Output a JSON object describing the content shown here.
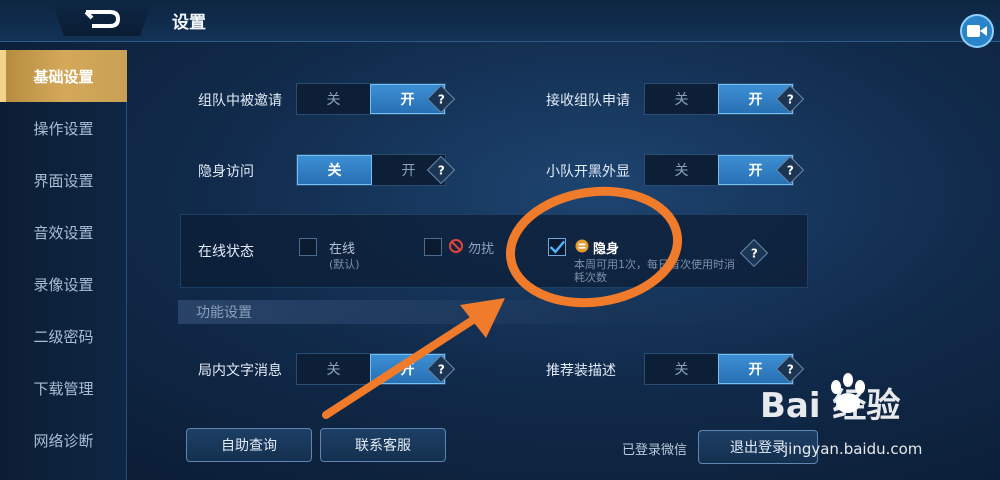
{
  "header": {
    "title": "设置"
  },
  "sidebar": {
    "items": [
      {
        "label": "基础设置",
        "active": true
      },
      {
        "label": "操作设置",
        "active": false
      },
      {
        "label": "界面设置",
        "active": false
      },
      {
        "label": "音效设置",
        "active": false
      },
      {
        "label": "录像设置",
        "active": false
      },
      {
        "label": "二级密码",
        "active": false
      },
      {
        "label": "下载管理",
        "active": false
      },
      {
        "label": "网络诊断",
        "active": false
      }
    ]
  },
  "settings": {
    "team_invite": {
      "label": "组队中被邀请",
      "off": "关",
      "on": "开",
      "value": "开"
    },
    "accept_team_request": {
      "label": "接收组队申请",
      "off": "关",
      "on": "开",
      "value": "开"
    },
    "stealth_visit": {
      "label": "隐身访问",
      "off": "关",
      "on": "开",
      "value": "关"
    },
    "squad_blacklist": {
      "label": "小队开黑外显",
      "off": "关",
      "on": "开",
      "value": "开"
    },
    "in_game_text": {
      "label": "局内文字消息",
      "off": "关",
      "on": "开",
      "value": "开"
    },
    "recommend_gear": {
      "label": "推荐装描述",
      "off": "关",
      "on": "开",
      "value": "开"
    }
  },
  "online_status": {
    "label": "在线状态",
    "options": [
      {
        "label": "在线",
        "sub": "(默认)",
        "checked": false
      },
      {
        "label": "勿扰",
        "checked": false
      },
      {
        "label": "隐身",
        "note": "本周可用1次，每日首次使用时消耗次数",
        "checked": true
      }
    ]
  },
  "section": {
    "label": "功能设置"
  },
  "help_symbol": "?",
  "footer": {
    "self_query": "自助查询",
    "contact_service": "联系客服",
    "wechat_status": "已登录微信",
    "logout": "退出登录"
  },
  "watermark": {
    "logo": "Bai 经验",
    "url": "jingyan.baidu.com"
  },
  "colors": {
    "accent": "#2f7fc4",
    "active_tab": "#c9a05a",
    "annotation": "#f07b2b"
  }
}
